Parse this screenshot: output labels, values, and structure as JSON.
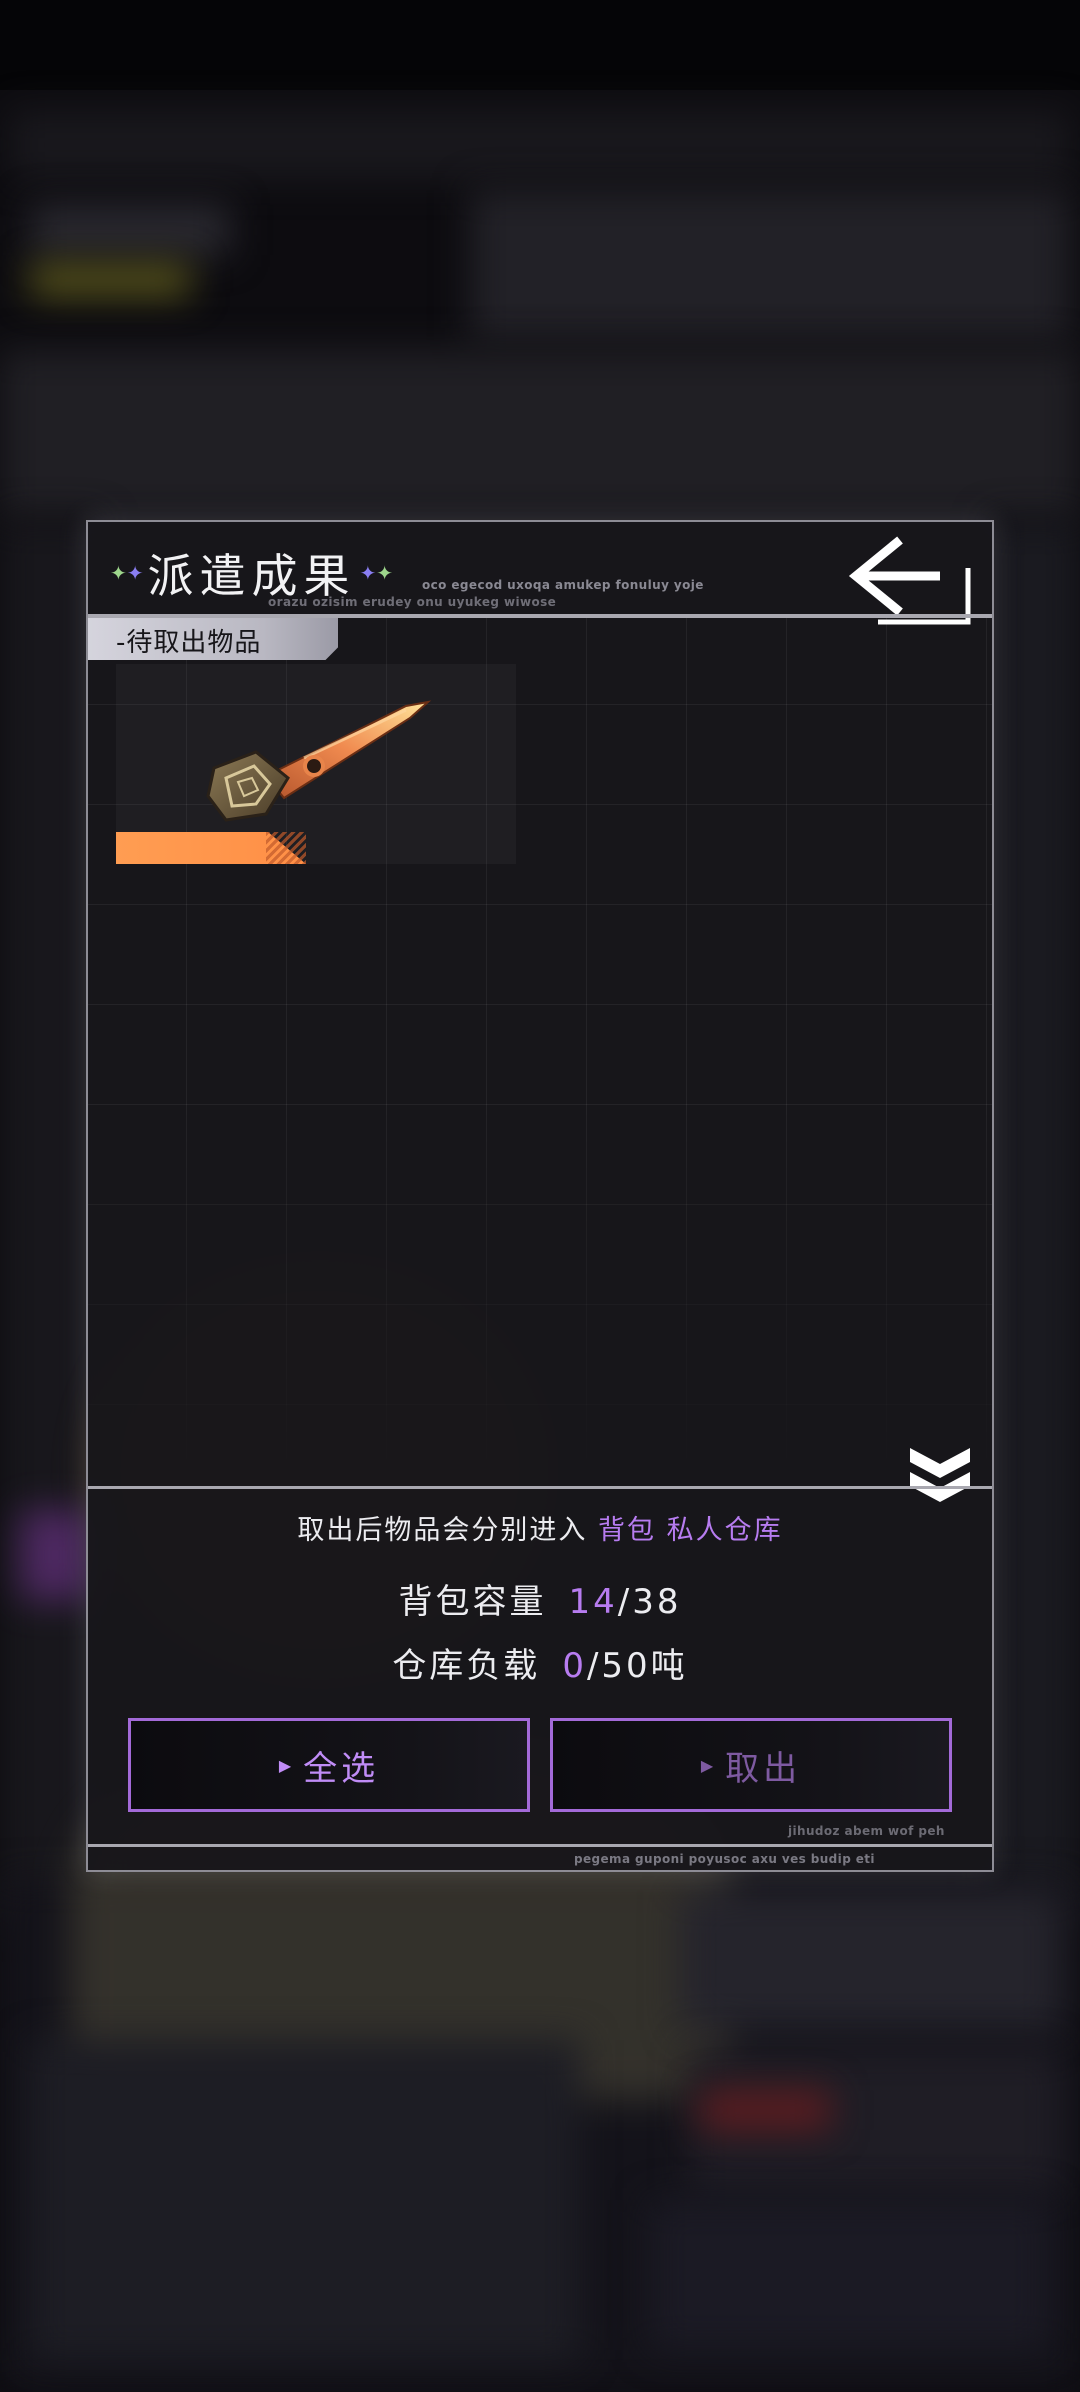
{
  "dialog": {
    "title": "派遣成果",
    "decor_text_1": "oco egecod uxoqa amukep fonuluy yoje",
    "decor_text_2": "orazu ozisim erudey onu uyukeg wiwose",
    "section_tag": "-待取出物品",
    "items": [
      {
        "icon": "spear-blade-icon",
        "rarity_color": "#ff9d52"
      }
    ],
    "hint_prefix": "取出后物品会分别进入",
    "hint_bag": "背包",
    "hint_warehouse": "私人仓库",
    "capacity": {
      "label": "背包容量",
      "current": "14",
      "sep_total": "/38"
    },
    "load": {
      "label": "仓库负载",
      "current": "0",
      "sep_total": "/50吨"
    },
    "buttons": {
      "select_all": "全选",
      "take_out": "取出"
    },
    "decor_text_3": "jihudoz abem wof peh",
    "decor_text_4": "pegema guponi poyusoc axu ves budip eti"
  },
  "icons": {
    "back": "back-arrow-icon",
    "collapse": "double-chevron-down-icon",
    "sparkle": "sparkle-icon",
    "button_arrow": "play-triangle-icon"
  },
  "colors": {
    "accent": "#b77cf0",
    "button_border": "#a36ad8",
    "rarity": "#ff9d52"
  }
}
